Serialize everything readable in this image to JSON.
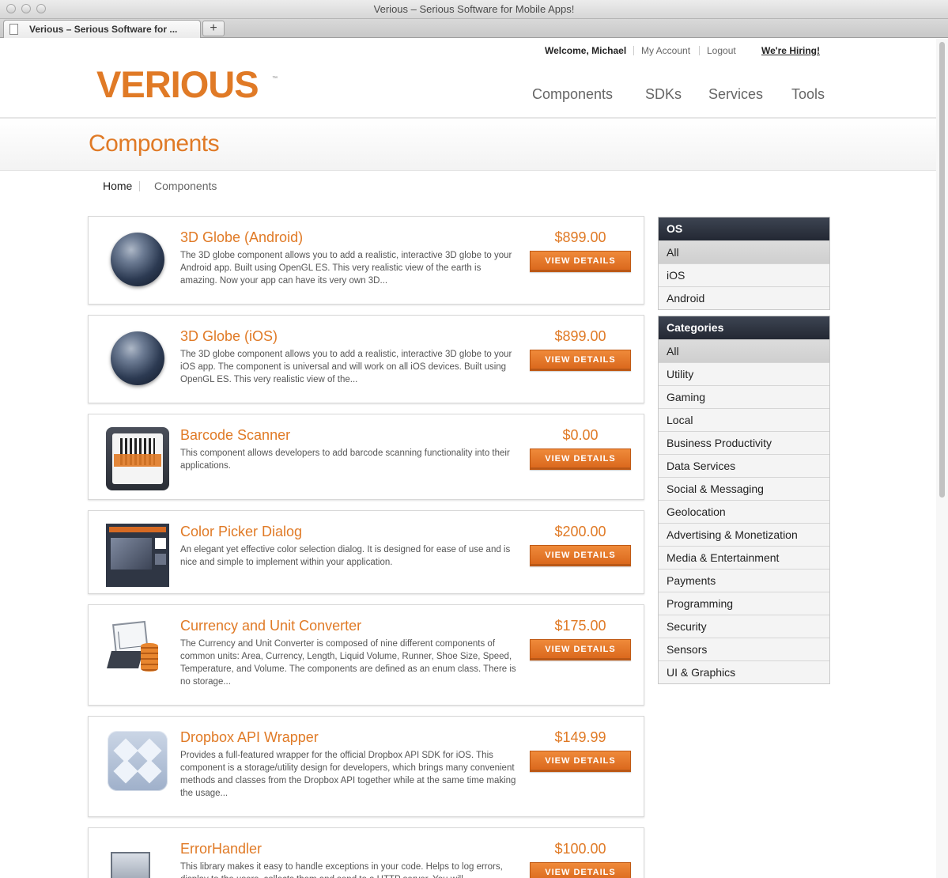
{
  "browser": {
    "window_title": "Verious – Serious Software for Mobile Apps!",
    "tab_label": "Verious – Serious Software for ...",
    "new_tab": "+"
  },
  "header": {
    "welcome": "Welcome, Michael",
    "my_account": "My Account",
    "logout": "Logout",
    "hiring": "We're Hiring!",
    "logo_text": "VERIOUS",
    "logo_tm": "™",
    "nav": [
      "Components",
      "SDKs",
      "Services",
      "Tools"
    ]
  },
  "page": {
    "title": "Components",
    "breadcrumb": [
      "Home",
      "Components"
    ]
  },
  "products": [
    {
      "name": "3D Globe (Android)",
      "description": "The 3D globe component allows you to add a realistic, interactive 3D globe to your Android app. Built using OpenGL ES. This very realistic view of the earth is amazing. Now your app can have its very own 3D...",
      "price": "$899.00",
      "button": "VIEW DETAILS",
      "icon": "globe-icon"
    },
    {
      "name": "3D Globe (iOS)",
      "description": "The 3D globe component allows you to add a realistic, interactive 3D globe to your iOS app. The component is universal and will work on all iOS devices. Built using OpenGL ES. This very realistic view of the...",
      "price": "$899.00",
      "button": "VIEW DETAILS",
      "icon": "globe-icon"
    },
    {
      "name": "Barcode Scanner",
      "description": "This component allows developers to add barcode scanning functionality into their applications.",
      "price": "$0.00",
      "button": "VIEW DETAILS",
      "icon": "barcode-icon"
    },
    {
      "name": "Color Picker Dialog",
      "description": "An elegant yet effective color selection dialog. It is designed for ease of use and is nice and simple to implement within your application.",
      "price": "$200.00",
      "button": "VIEW DETAILS",
      "icon": "color-picker-icon"
    },
    {
      "name": "Currency and Unit Converter",
      "description": "The Currency and Unit Converter is composed of nine different components of common units: Area, Currency, Length, Liquid Volume, Runner, Shoe Size, Speed, Temperature, and Volume. The components are defined as an enum class. There is no storage...",
      "price": "$175.00",
      "button": "VIEW DETAILS",
      "icon": "currency-chart-icon"
    },
    {
      "name": "Dropbox API Wrapper",
      "description": "Provides a full-featured wrapper for the official Dropbox API SDK for iOS. This component is a storage/utility design for developers, which brings many convenient methods and classes from the Dropbox API together while at the same time making the usage...",
      "price": "$149.99",
      "button": "VIEW DETAILS",
      "icon": "dropbox-icon"
    },
    {
      "name": "ErrorHandler",
      "description": "This library makes it easy to handle exceptions in your code. Helps to log errors, display to the users, collects them and send to a HTTP server. You will",
      "price": "$100.00",
      "button": "VIEW DETAILS",
      "icon": "monitor-icon"
    }
  ],
  "sidebar": {
    "os": {
      "title": "OS",
      "items": [
        "All",
        "iOS",
        "Android"
      ],
      "selected": "All"
    },
    "categories": {
      "title": "Categories",
      "items": [
        "All",
        "Utility",
        "Gaming",
        "Local",
        "Business Productivity",
        "Data Services",
        "Social & Messaging",
        "Geolocation",
        "Advertising & Monetization",
        "Media & Entertainment",
        "Payments",
        "Programming",
        "Security",
        "Sensors",
        "UI & Graphics"
      ],
      "selected": "All"
    }
  },
  "colors": {
    "brand_orange": "#e07a26",
    "sidebar_header": "#2b303b"
  }
}
